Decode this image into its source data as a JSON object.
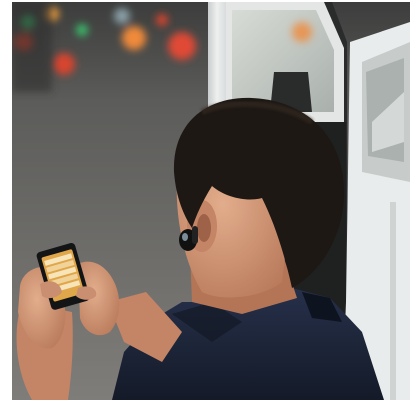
{
  "photo": {
    "subject": "man-using-smartphone-with-bluetooth-headset-beside-white-car",
    "colors": {
      "background": "#6e6d6a",
      "shirt": "#1b2233",
      "hair": "#1e1814",
      "skin": "#c98f70",
      "car": "#e9ecec",
      "bokeh_red": "#d8452e",
      "bokeh_orange": "#f08a3a",
      "bokeh_green": "#3bbf6b",
      "phone_screen": "#e0a64a"
    }
  }
}
